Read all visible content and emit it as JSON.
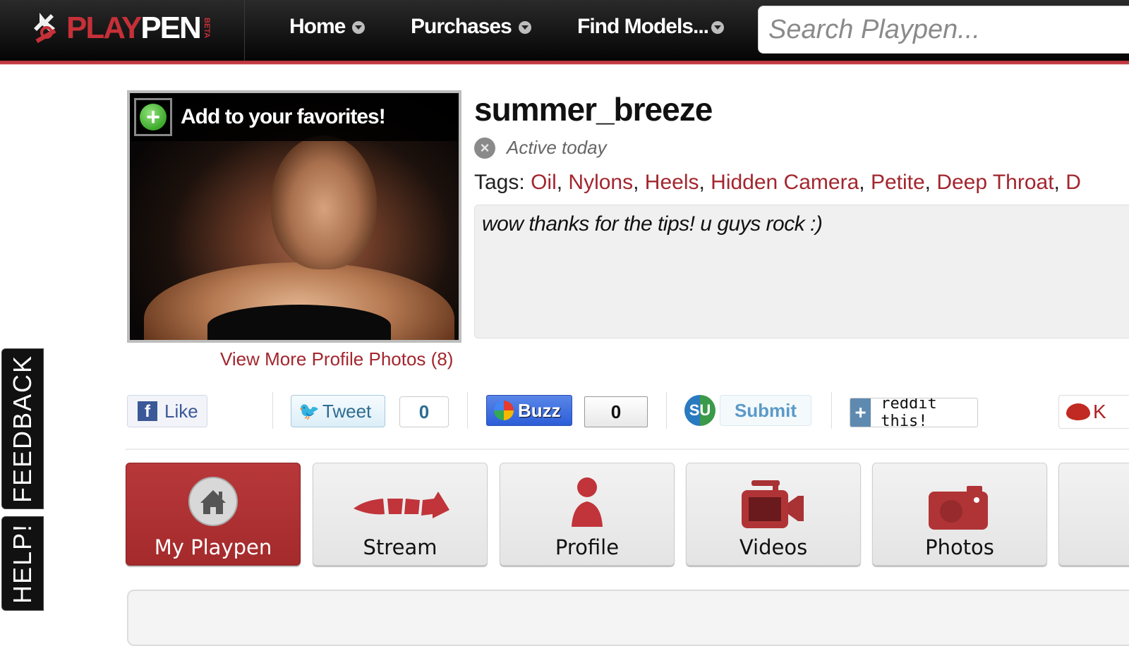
{
  "header": {
    "logo_play": "PLAY",
    "logo_pen": "PEN",
    "logo_beta": "BETA",
    "nav": [
      {
        "label": "Home"
      },
      {
        "label": "Purchases"
      },
      {
        "label": "Find Models..."
      }
    ],
    "search_placeholder": "Search Playpen..."
  },
  "side_tabs": {
    "feedback": "FEEDBACK",
    "help": "HELP!"
  },
  "profile": {
    "favorites_label": "Add to your favorites!",
    "more_photos": "View More Profile Photos (8)",
    "username": "summer_breeze",
    "activity": "Active today",
    "tags_label": "Tags:",
    "tags": [
      "Oil",
      "Nylons",
      "Heels",
      "Hidden Camera",
      "Petite",
      "Deep Throat",
      "D"
    ],
    "status": "wow thanks for the tips! u guys rock :)"
  },
  "share": {
    "facebook": "Like",
    "tweet": "Tweet",
    "tweet_count": "0",
    "buzz": "Buzz",
    "buzz_count": "0",
    "stumble_icon": "SU",
    "submit": "Submit",
    "reddit": "reddit this!",
    "kiss": "K"
  },
  "tiles": [
    {
      "label": "My Playpen",
      "icon": "home-icon",
      "active": true
    },
    {
      "label": "Stream",
      "icon": "arrow-icon",
      "active": false
    },
    {
      "label": "Profile",
      "icon": "person-icon",
      "active": false
    },
    {
      "label": "Videos",
      "icon": "video-camera-icon",
      "active": false
    },
    {
      "label": "Photos",
      "icon": "camera-icon",
      "active": false
    }
  ],
  "colors": {
    "brand_red": "#a3262e",
    "topbar": "#050505"
  }
}
